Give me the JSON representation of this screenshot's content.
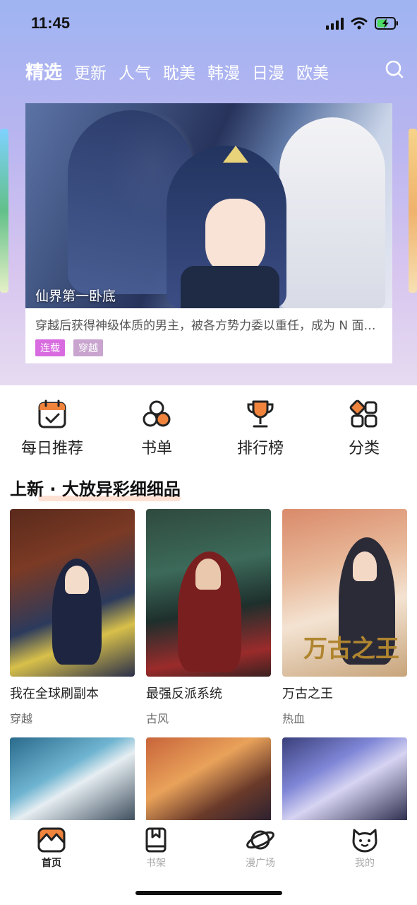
{
  "status": {
    "time": "11:45"
  },
  "tabs": [
    {
      "label": "精选",
      "active": true
    },
    {
      "label": "更新"
    },
    {
      "label": "人气"
    },
    {
      "label": "耽美"
    },
    {
      "label": "韩漫"
    },
    {
      "label": "日漫"
    },
    {
      "label": "欧美"
    }
  ],
  "search": {
    "icon": "search-icon"
  },
  "banner": {
    "title": "仙界第一卧底",
    "description": "穿越后获得神级体质的男主，被各方势力委以重任，成为 N 面…",
    "tags": [
      {
        "label": "连载",
        "color": "#d86be0"
      },
      {
        "label": "穿越",
        "color": "#c8a4cf"
      }
    ]
  },
  "shortcuts": [
    {
      "label": "每日推荐",
      "icon": "calendar-check-icon"
    },
    {
      "label": "书单",
      "icon": "circles-icon"
    },
    {
      "label": "排行榜",
      "icon": "trophy-icon"
    },
    {
      "label": "分类",
      "icon": "grid-category-icon"
    }
  ],
  "section": {
    "title": "上新 · 大放异彩细细品"
  },
  "comics": [
    {
      "title": "我在全球刷副本",
      "genre": "穿越"
    },
    {
      "title": "最强反派系统",
      "genre": "古风"
    },
    {
      "title": "万古之王",
      "genre": "热血"
    }
  ],
  "bottom_nav": [
    {
      "label": "首页",
      "icon": "home-icon",
      "active": true
    },
    {
      "label": "书架",
      "icon": "bookshelf-icon"
    },
    {
      "label": "漫广场",
      "icon": "planet-icon"
    },
    {
      "label": "我的",
      "icon": "profile-icon"
    }
  ],
  "colors": {
    "accent": "#f0843c",
    "tab_text": "#ffffff"
  }
}
